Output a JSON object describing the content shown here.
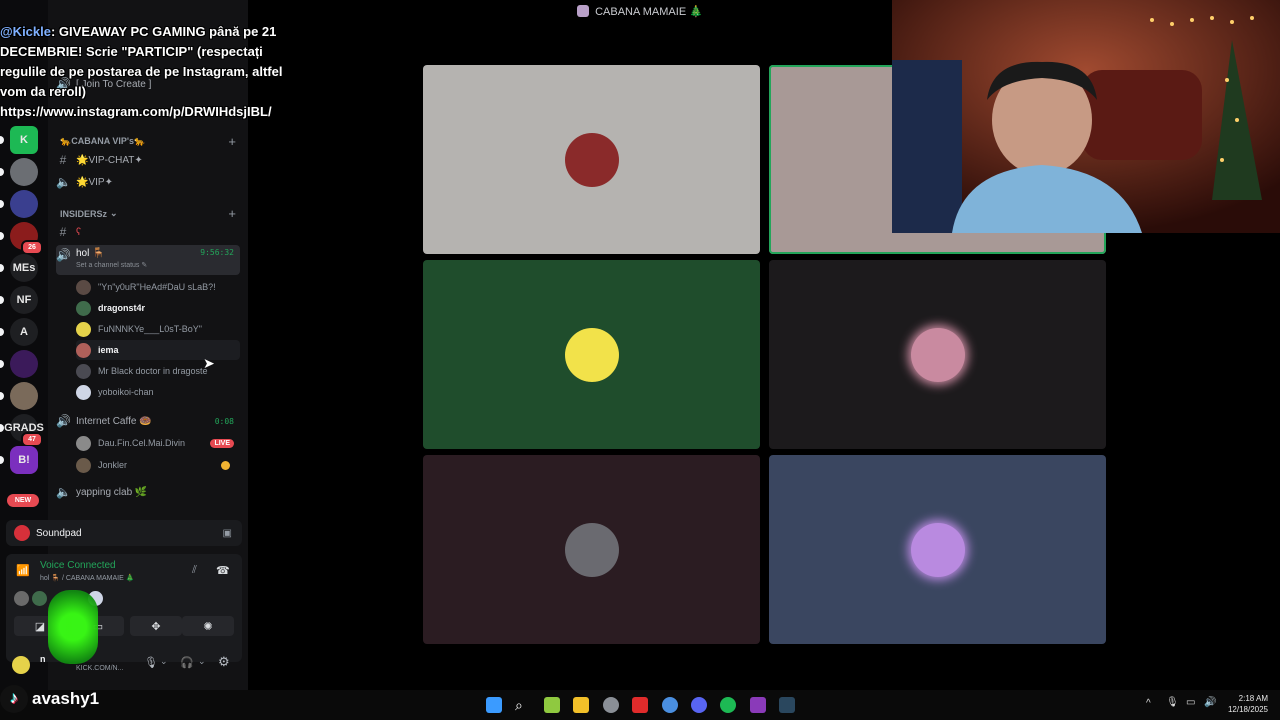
{
  "window": {
    "title": "CABANA MAMAIE 🎄"
  },
  "announcement": {
    "user": "@Kickle",
    "message": ": GIVEAWAY PC GAMING până pe 21 DECEMBRIE! Scrie \"PARTICIP\" (respectați regulile de pe postarea de pe Instagram, altfel vom da reroll)",
    "link": "https://www.instagram.com/p/DRWIHdsjIBL/"
  },
  "server_rail": {
    "items": [
      {
        "label": "K",
        "color": "#1db954"
      },
      {
        "label": "",
        "color": "#6b6e73"
      },
      {
        "label": "",
        "color": "#3a3f8f"
      },
      {
        "label": "",
        "color": "#8b1c1c",
        "badge": "26"
      },
      {
        "label": "MEs",
        "color": "#1e1f22"
      },
      {
        "label": "NF",
        "color": "#1e1f22"
      },
      {
        "label": "A",
        "color": "#1e1f22"
      },
      {
        "label": "",
        "color": "#3b1a5a"
      },
      {
        "label": "",
        "color": "#7a6a5a"
      },
      {
        "label": "GRADS",
        "color": "#1e1f22",
        "badge": "47"
      },
      {
        "label": "B!",
        "color": "#7b2fbe"
      }
    ],
    "new_badge": "NEW"
  },
  "channels": {
    "top_partial": "[ Join To Create ]",
    "category_vip": "🐆CABANA VIP's🐆",
    "vip_chat": "🌟VIP-CHAT✦",
    "vip_voice": "🌟VIP✦",
    "category_insiders": "INSIDERSz",
    "insiders_text": "ʕ",
    "active_voice": {
      "name": "hol 🪑",
      "timer": "9:56:32",
      "status": "Set a channel status ✎"
    },
    "members": [
      {
        "name": "\"Yn\"y0uR\"HeAd#DaU sLaB?!",
        "bright": false,
        "color": "#5a4a44"
      },
      {
        "name": "dragonst4r",
        "bright": true,
        "color": "#3f6b4b"
      },
      {
        "name": "FuNNNKYe___L0sT-BoY\"",
        "bright": false,
        "color": "#e5d24a"
      },
      {
        "name": "iema",
        "bright": true,
        "color": "#b0605a"
      },
      {
        "name": "Mr Black doctor in dragoste",
        "bright": false,
        "color": "#4a4a52"
      },
      {
        "name": "yoboikoi-chan",
        "bright": false,
        "color": "#cfd6e6"
      }
    ],
    "second_voice": {
      "name": "Internet Caffe 🍩",
      "timer": "0:08"
    },
    "second_members": [
      {
        "name": "Dau.Fin.Cel.Mai.Divin",
        "live": "LIVE",
        "color": "#8a8a8a"
      },
      {
        "name": "Jonkler",
        "color": "#6a5a4a"
      }
    ],
    "third_voice": "yapping clab 🌿"
  },
  "panel": {
    "soundpad": "Soundpad",
    "voice_status": "Voice Connected",
    "voice_channel": "hol 🪑 / CABANA MAMAIE 🎄",
    "user_name": "n",
    "user_status": "KICK.COM/N..."
  },
  "video_tiles": [
    {
      "bg": "#b5b3b0",
      "avatar": "#8a2a2a"
    },
    {
      "bg": "#a89996",
      "avatar": "",
      "speaking": true
    },
    {
      "bg": "#1f4d2c",
      "avatar": "#f2e24a"
    },
    {
      "bg": "#1c1a1c",
      "avatar": "#c98aa0"
    },
    {
      "bg": "#2b1c22",
      "avatar": "#6a6a70"
    },
    {
      "bg": "#3a4660",
      "avatar": "#b98ae0"
    }
  ],
  "taskbar": {
    "time": "2:18 AM",
    "date": "12/18/2025"
  },
  "overlay": {
    "tiktok_name": "avashy1"
  }
}
